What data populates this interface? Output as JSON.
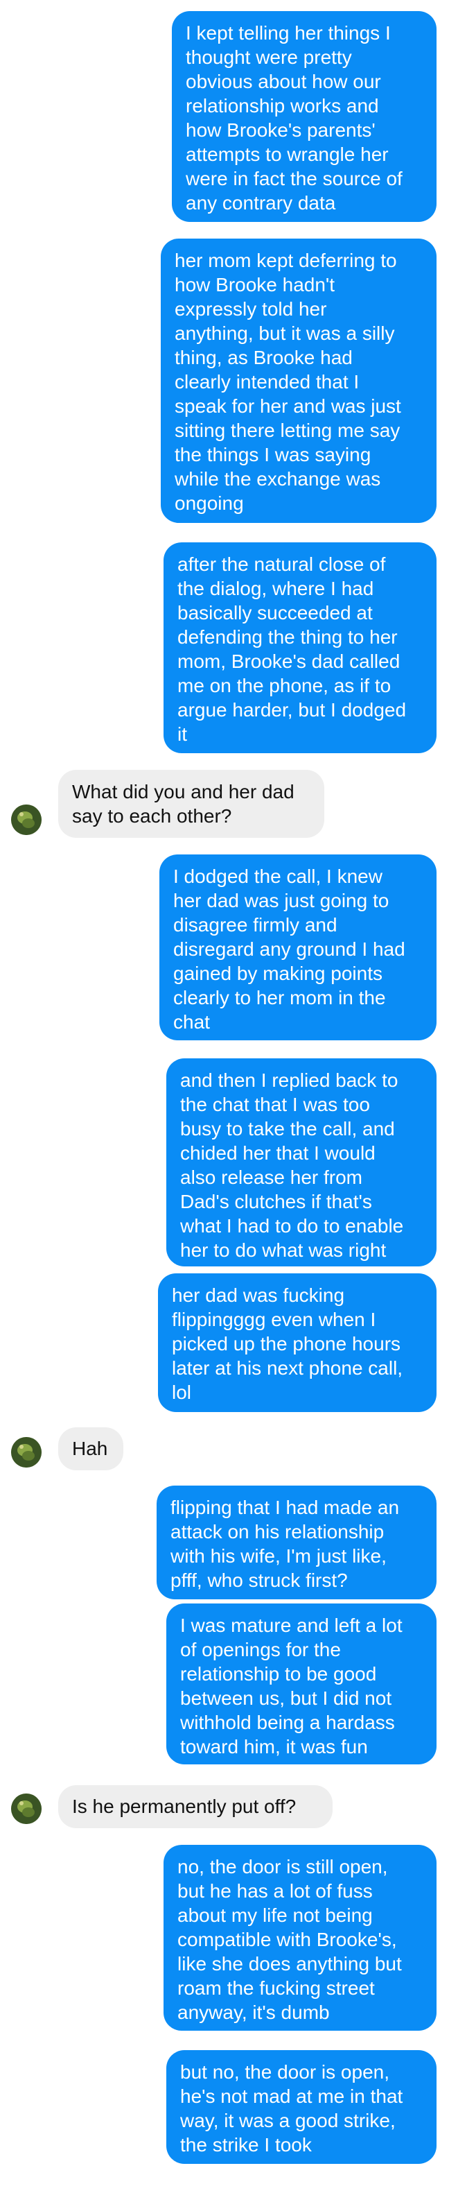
{
  "messages": [
    {
      "from": "me",
      "text": "I kept telling her things I\nthought were pretty\nobvious about how our\nrelationship works and\nhow Brooke's parents'\nattempts to wrangle her\nwere in fact the source of\nany contrary data"
    },
    {
      "from": "me",
      "text": "her mom kept deferring to\nhow Brooke hadn't\nexpressly told her\nanything, but it was a silly\nthing, as Brooke had\nclearly intended that I\nspeak for her and was just\nsitting there letting me say\nthe things I was saying\nwhile the exchange was\nongoing"
    },
    {
      "from": "me",
      "text": "after the natural close of\nthe dialog, where I had\nbasically succeeded at\ndefending the thing to her\nmom, Brooke's dad called\nme on the phone, as if to\nargue harder, but I dodged\nit"
    },
    {
      "from": "them",
      "text": "What did you and her dad\nsay to each other?"
    },
    {
      "from": "me",
      "text": "I dodged the call, I knew\nher dad was just going to\ndisagree firmly and\ndisregard any ground I had\ngained by making points\nclearly to her mom in the\nchat"
    },
    {
      "from": "me",
      "text": "and then I replied back to\nthe chat that I was too\nbusy to take the call, and\nchided her that I would\nalso release her from\nDad's clutches if that's\nwhat I had to do to enable\nher to do what was right"
    },
    {
      "from": "me",
      "text": "her dad was fucking\nflippingggg even when I\npicked up the phone hours\nlater at his next phone call,\nlol"
    },
    {
      "from": "them",
      "text": "Hah"
    },
    {
      "from": "me",
      "text": "flipping that I had made an\nattack on his relationship\nwith his wife, I'm just like,\npfff, who struck first?"
    },
    {
      "from": "me",
      "text": "I was mature and left a lot\nof openings for the\nrelationship to be good\nbetween us, but I did not\nwithhold being a hardass\ntoward him, it was fun"
    },
    {
      "from": "them",
      "text": "Is he permanently put off?"
    },
    {
      "from": "me",
      "text": "no, the door is still open,\nbut he has a lot of fuss\nabout my life not being\ncompatible with Brooke's,\nlike she does anything but\nroam the fucking street\nanyway, it's dumb"
    },
    {
      "from": "me",
      "text": "but no, the door is open,\nhe's not mad at me in that\nway, it was a good strike,\nthe strike I took"
    }
  ]
}
